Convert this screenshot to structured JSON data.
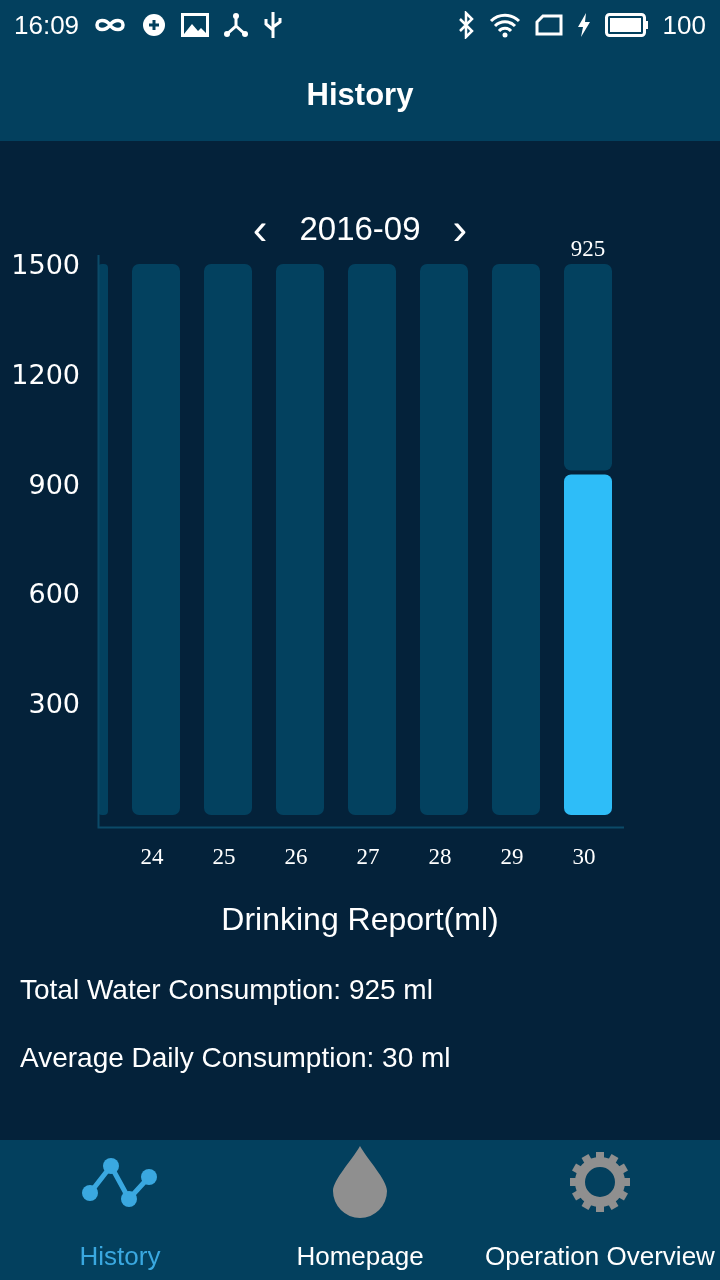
{
  "status_bar": {
    "time": "16:09",
    "battery": "100"
  },
  "header": {
    "title": "History"
  },
  "month_nav": {
    "prev": "‹",
    "label": "2016-09",
    "next": "›"
  },
  "chart": {
    "chart_data": {
      "type": "bar",
      "categories": [
        "24",
        "25",
        "26",
        "27",
        "28",
        "29",
        "30"
      ],
      "series": [
        {
          "color": "#2ebdf8",
          "values": [
            0,
            0,
            0,
            0,
            0,
            0,
            925
          ]
        },
        {
          "color": "#03415f",
          "values": [
            1500,
            1500,
            1500,
            1500,
            1500,
            1500,
            575
          ]
        }
      ],
      "stacked": true,
      "ylim": [
        0,
        1500
      ],
      "yticks": [
        300,
        600,
        900,
        1200,
        1500
      ],
      "annotations": [
        "925"
      ]
    }
  },
  "report": {
    "title": "Drinking Report(ml)",
    "lines": [
      "Total Water Consumption: 925 ml",
      "Average Daily Consumption: 30 ml"
    ]
  },
  "bottom_nav": [
    {
      "label": "History",
      "kind": "history",
      "selected": true
    },
    {
      "label": "Homepage",
      "kind": "home",
      "selected": false
    },
    {
      "label": "Operation Overview",
      "kind": "settings",
      "selected": false
    }
  ]
}
